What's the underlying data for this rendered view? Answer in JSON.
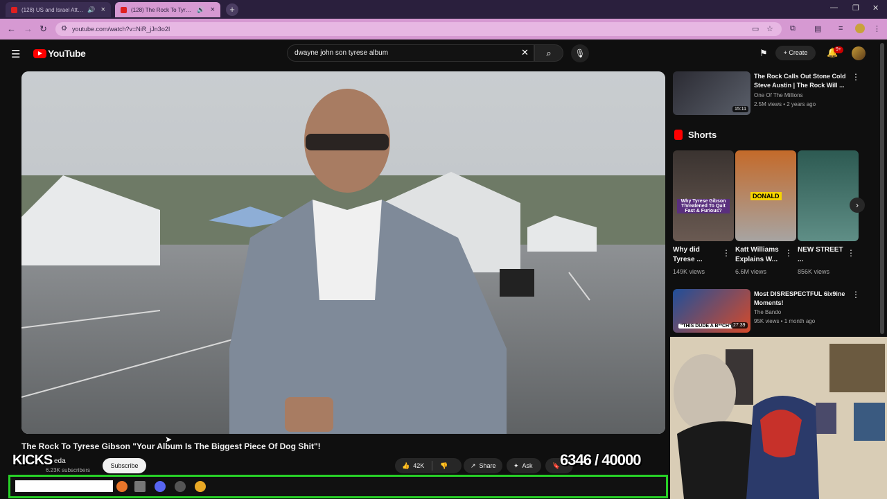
{
  "browser": {
    "tabs": [
      {
        "title": "(128) US and Israel Attack In",
        "active": false,
        "audio": true
      },
      {
        "title": "(128) The Rock To Tyrese G",
        "active": true,
        "audio": true
      }
    ],
    "new_tab_icon": "plus-icon",
    "url": "youtube.com/watch?v=NiR_jJn3o2I",
    "accent": "#d699d2"
  },
  "youtube": {
    "logo_text": "YouTube",
    "search_query": "dwayne john son tyrese album",
    "create_label": "Create",
    "notification_count": "9+",
    "brand_color": "#ff0000"
  },
  "video": {
    "title": "The Rock To Tyrese Gibson \"Your Album Is The Biggest Piece Of Dog Shit\"!",
    "channel": "eda",
    "subscribers": "6.23K subscribers",
    "subscribe_label": "Subscribe",
    "likes": "42K",
    "share_label": "Share",
    "ask_label": "Ask"
  },
  "overlay": {
    "kicks_label": "KICKS",
    "counter": "6346 / 40000",
    "frame_color": "#27d127"
  },
  "sidebar": {
    "top_rec": {
      "title": "The Rock Calls Out Stone Cold Steve Austin | The Rock Will ...",
      "channel": "One Of The Millions",
      "meta": "2.5M views • 2 years ago",
      "duration": "15:11"
    },
    "shorts_label": "Shorts",
    "shorts": [
      {
        "title": "Why did Tyrese ...",
        "views": "149K views",
        "overlay": "Why Tyrese Gibson Threatened To Quit Fast & Furious?"
      },
      {
        "title": "Katt Williams Explains W...",
        "views": "6.6M views",
        "overlay": "DONALD"
      },
      {
        "title": "NEW STREET ...",
        "views": "856K views",
        "overlay": ""
      }
    ],
    "bottom_rec": {
      "title": "Most DISRESPECTFUL 6ix9ine Moments!",
      "channel": "The Bando",
      "meta": "95K views • 1 month ago",
      "duration": "27:39",
      "overlay": "\"THIS DUDE A B**CH\""
    }
  }
}
